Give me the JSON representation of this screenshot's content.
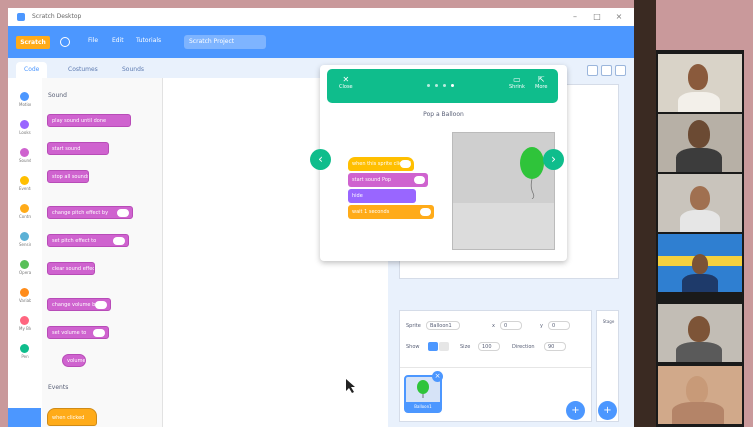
{
  "window": {
    "title": "Scratch Desktop",
    "controls": [
      "–",
      "□",
      "×"
    ]
  },
  "menubar": {
    "logo": "Scratch",
    "items": [
      "File",
      "Edit",
      "Tutorials"
    ],
    "project_title": "Scratch Project"
  },
  "tabs": [
    "Code",
    "Costumes",
    "Sounds"
  ],
  "categories": [
    {
      "label": "Motion",
      "color": "#4c97ff"
    },
    {
      "label": "Looks",
      "color": "#9966ff"
    },
    {
      "label": "Sound",
      "color": "#cf63cf"
    },
    {
      "label": "Events",
      "color": "#ffbf00"
    },
    {
      "label": "Control",
      "color": "#ffab19"
    },
    {
      "label": "Sensing",
      "color": "#5cb1d6"
    },
    {
      "label": "Operators",
      "color": "#59c059"
    },
    {
      "label": "Variables",
      "color": "#ff8c1a"
    },
    {
      "label": "My Blocks",
      "color": "#ff6680"
    },
    {
      "label": "Pen",
      "color": "#0fbd8c"
    }
  ],
  "palette": {
    "section_sound": "Sound",
    "section_events": "Events",
    "blocks": [
      "play sound until done",
      "start sound",
      "stop all sounds",
      "change pitch effect by",
      "set pitch effect to",
      "clear sound effects",
      "change volume by",
      "set volume to",
      "volume"
    ],
    "events_block": "when clicked"
  },
  "tutorial": {
    "close_label": "Close",
    "shrink_label": "Shrink",
    "more_label": "More",
    "title": "Pop a Balloon",
    "script": [
      "when this sprite clicked",
      "start sound Pop",
      "hide",
      "wait 1 seconds"
    ],
    "balloon_color": "#2fc43a"
  },
  "sprite_info": {
    "sprite_label": "Sprite",
    "sprite_name": "Balloon1",
    "x_label": "x",
    "x_value": "0",
    "y_label": "y",
    "y_value": "0",
    "show_label": "Show",
    "size_label": "Size",
    "size_value": "100",
    "direction_label": "Direction",
    "direction_value": "90"
  },
  "sprite_tile_label": "Balloon1",
  "stage_panel_label": "Stage",
  "colors": {
    "accent": "#4c97ff",
    "tutorial_green": "#0fbd8c",
    "sound_block": "#cf63cf",
    "control_block": "#ffab19"
  }
}
